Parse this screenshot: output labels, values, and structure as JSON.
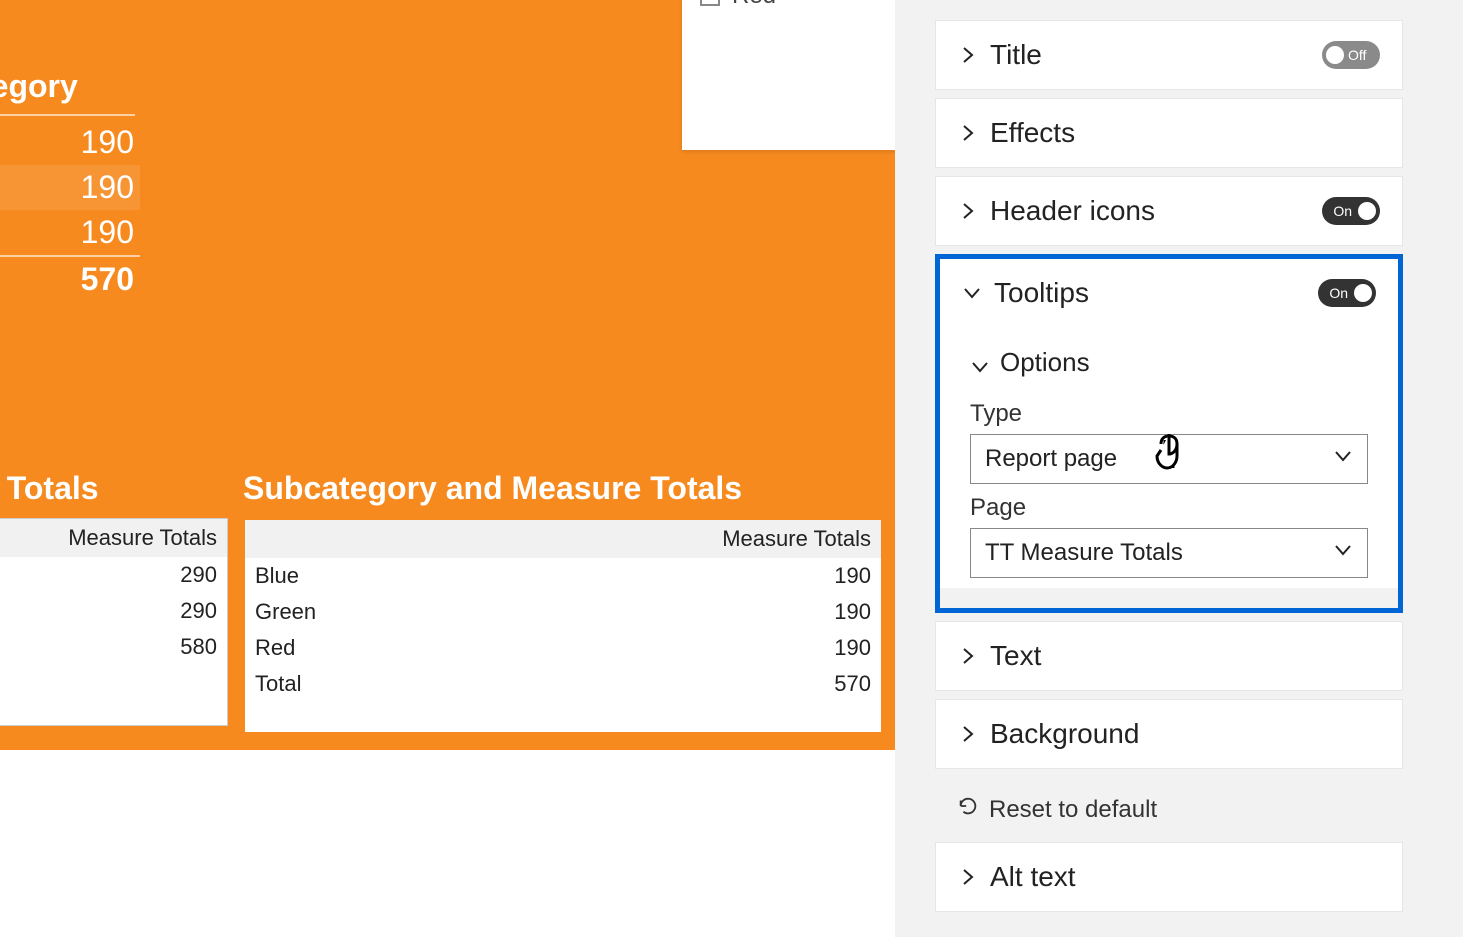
{
  "slicer": {
    "items": [
      "Red"
    ]
  },
  "upper": {
    "header": "tegory",
    "rows": [
      190,
      190,
      190
    ],
    "total": 570
  },
  "leftTable": {
    "title": "e Totals",
    "header_measure": "Measure Totals",
    "rows": [
      {
        "val": 290
      },
      {
        "val": 290
      },
      {
        "val": 580
      }
    ]
  },
  "subTable": {
    "title": "Subcategory and Measure Totals",
    "header_measure": "Measure Totals",
    "rows": [
      {
        "name": "Blue",
        "val": 190
      },
      {
        "name": "Green",
        "val": 190
      },
      {
        "name": "Red",
        "val": 190
      },
      {
        "name": "Total",
        "val": 570
      }
    ]
  },
  "format": {
    "title": {
      "label": "Title",
      "state": "Off"
    },
    "effects": {
      "label": "Effects"
    },
    "headerIcons": {
      "label": "Header icons",
      "state": "On"
    },
    "tooltips": {
      "label": "Tooltips",
      "state": "On",
      "options": {
        "label": "Options",
        "type": {
          "label": "Type",
          "value": "Report page"
        },
        "page": {
          "label": "Page",
          "value": "TT Measure Totals"
        }
      }
    },
    "text": {
      "label": "Text"
    },
    "background": {
      "label": "Background"
    },
    "reset": {
      "label": "Reset to default"
    },
    "altText": {
      "label": "Alt text"
    }
  }
}
